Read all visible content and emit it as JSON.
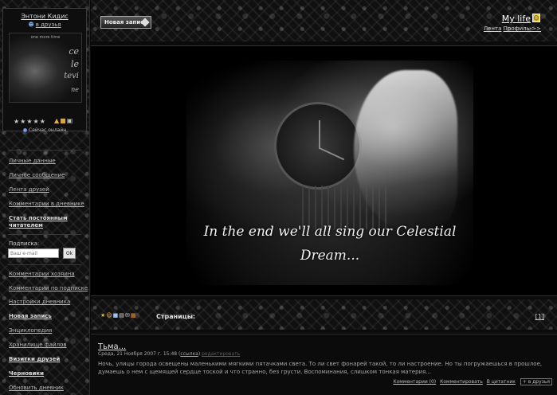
{
  "profile": {
    "user_name": "Энтони Кидис",
    "add_friend": "в друзья",
    "avatar_caption": "one more time",
    "avatar_text_lines": [
      "ce",
      "le",
      "tevi",
      "ne"
    ],
    "rating_stars": "★★★★★",
    "online_status": "Сейчас онлайн"
  },
  "menu_a": [
    "Личные данные",
    "Личное сообщение",
    "Лента друзей",
    "Комментарии в дневнике"
  ],
  "become_reader": "Стать постоянным читателем",
  "subscription": {
    "label": "Подписка:",
    "email_placeholder": "Ваш e-mail",
    "ok_label": "Ok"
  },
  "menu_b": [
    {
      "label": "Комментарии хозяина",
      "bold": false
    },
    {
      "label": "Комментарии по подписке",
      "bold": false
    },
    {
      "label": "Настройки дневника",
      "bold": false
    },
    {
      "label": "Новая запись",
      "bold": true
    },
    {
      "label": "Энциклопедия",
      "bold": false
    },
    {
      "label": "Хранилище файлов",
      "bold": false
    },
    {
      "label": "Визитки друзей",
      "bold": true
    },
    {
      "label": "Черновики",
      "bold": true
    },
    {
      "label": "Обновить дневник",
      "bold": false
    }
  ],
  "header": {
    "new_post": "Новая запись",
    "diary_title": "My life",
    "link_feed": "Лента",
    "link_profile": "Профиль->>"
  },
  "banner": {
    "quote": "In the end we'll all sing our Celestial Dream..."
  },
  "pages": {
    "label": "Страницы:",
    "current": "[1]"
  },
  "post": {
    "title": "Тьма...",
    "date": "Среда, 21 Ноября 2007 г. 15:48",
    "link_label": "ссылка",
    "edit_label": "редактировать",
    "text": "Ночь, улицы города освещены маленькими мягкими пятачками света. То ли свет фонарей такой, то ли настроение. Но ты погружаешься в прошлое, думаешь о нем с щемящей сердце тоской и что странно, без грусти. Воспоминания, слишком тонкая материя...",
    "comments": "Комментарии (0)",
    "comment_action": "Комментировать",
    "quote_action": "В цитатник",
    "to_friends": "+ в друзья"
  },
  "colors": {
    "background": "#0b0b0b",
    "text": "#cfcfcf",
    "accent_badge": "#e8c84a"
  }
}
